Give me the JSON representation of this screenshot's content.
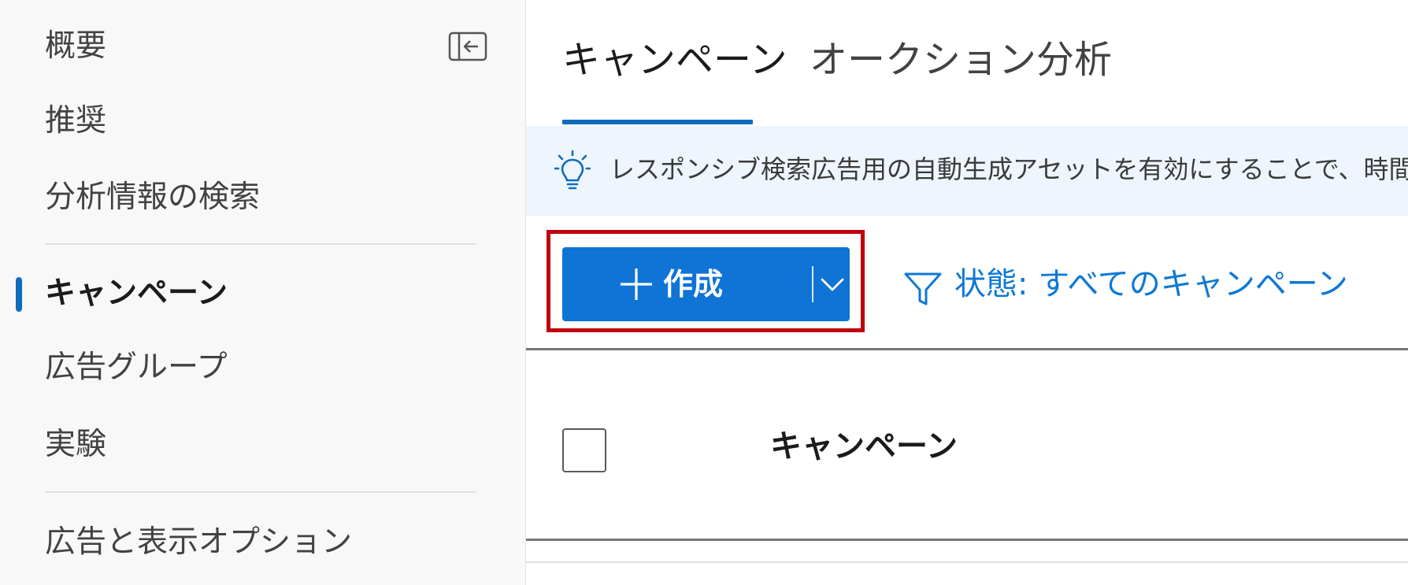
{
  "sidebar": {
    "items": [
      {
        "label": "概要"
      },
      {
        "label": "推奨"
      },
      {
        "label": "分析情報の検索"
      },
      {
        "label": "キャンペーン"
      },
      {
        "label": "広告グループ"
      },
      {
        "label": "実験"
      },
      {
        "label": "広告と表示オプション"
      }
    ],
    "active_index": 3,
    "collapse_icon": "collapse-sidebar-icon"
  },
  "tabs": [
    {
      "label": "キャンペーン",
      "active": true
    },
    {
      "label": "オークション分析",
      "active": false
    }
  ],
  "banner": {
    "icon": "lightbulb-icon",
    "text": "レスポンシブ検索広告用の自動生成アセットを有効にすることで、時間を節"
  },
  "toolbar": {
    "create_label": "作成",
    "create_icon": "plus-icon",
    "dropdown_icon": "chevron-down-icon",
    "filter_icon": "filter-icon",
    "filter_label": "状態: すべてのキャンペーン"
  },
  "table": {
    "columns": [
      "キャンペーン"
    ]
  },
  "colors": {
    "accent": "#0f6cbd",
    "primary_button": "#0f74d6",
    "link": "#0f78d4",
    "highlight_border": "#c1000f",
    "banner_bg": "#eef5fc",
    "sidebar_bg": "#f8f8f8"
  }
}
